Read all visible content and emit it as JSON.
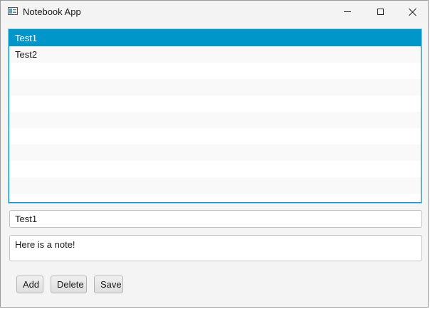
{
  "window": {
    "title": "Notebook App",
    "app_icon": "notebook-icon"
  },
  "titlebar_controls": [
    "minimize-icon",
    "maximize-icon",
    "close-icon"
  ],
  "list": {
    "selected_index": 0,
    "items": [
      "Test1",
      "Test2",
      "",
      "",
      "",
      "",
      "",
      "",
      "",
      ""
    ],
    "colors": {
      "selection": "#0096c9",
      "alt_row": "#f9f9f9"
    }
  },
  "editor": {
    "title_value": "Test1",
    "note_value": "Here is a note!"
  },
  "buttons": {
    "add": "Add",
    "delete": "Delete",
    "save": "Save"
  }
}
